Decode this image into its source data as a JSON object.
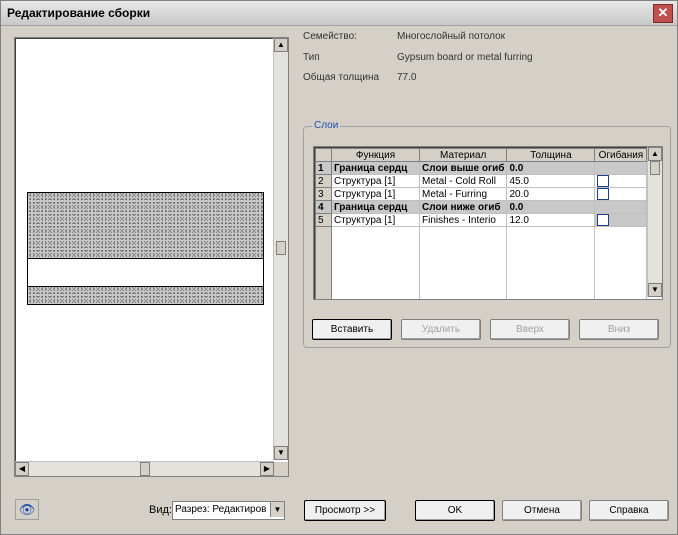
{
  "window": {
    "title": "Редактирование сборки",
    "close_symbol": "✕"
  },
  "properties": {
    "family_label": "Семейство:",
    "family_value": "Многослойный потолок",
    "type_label": "Тип",
    "type_value": "Gypsum board or metal furring",
    "thickness_label": "Общая толщина",
    "thickness_value": "77.0"
  },
  "layers": {
    "group_label": "Слои",
    "columns": [
      "",
      "Функция",
      "Материал",
      "Толщина",
      "Огибания"
    ],
    "rows": [
      {
        "num": "1",
        "function": "Граница сердц",
        "material": "Слои выше огиб",
        "thickness": "0.0",
        "wrap": false,
        "core": true
      },
      {
        "num": "2",
        "function": "Структура [1]",
        "material": "Metal - Cold Roll",
        "thickness": "45.0",
        "wrap": true,
        "core": false
      },
      {
        "num": "3",
        "function": "Структура [1]",
        "material": "Metal - Furring",
        "thickness": "20.0",
        "wrap": true,
        "core": false
      },
      {
        "num": "4",
        "function": "Граница сердц",
        "material": "Слои ниже огиб",
        "thickness": "0.0",
        "wrap": false,
        "core": true
      },
      {
        "num": "5",
        "function": "Структура [1]",
        "material": "Finishes - Interio",
        "thickness": "12.0",
        "wrap": true,
        "core": false
      }
    ]
  },
  "layer_buttons": {
    "insert": "Вставить",
    "delete": "Удалить",
    "up": "Вверх",
    "down": "Вниз"
  },
  "view": {
    "label": "Вид:",
    "selected": "Разрез: Редактиров"
  },
  "buttons": {
    "preview": "Просмотр >>",
    "ok": "OK",
    "cancel": "Отмена",
    "help": "Справка"
  },
  "icons": {
    "eye": "👁",
    "scroll_up": "▲",
    "scroll_down": "▼",
    "scroll_left": "◀",
    "scroll_right": "▶",
    "dropdown": "▼"
  }
}
